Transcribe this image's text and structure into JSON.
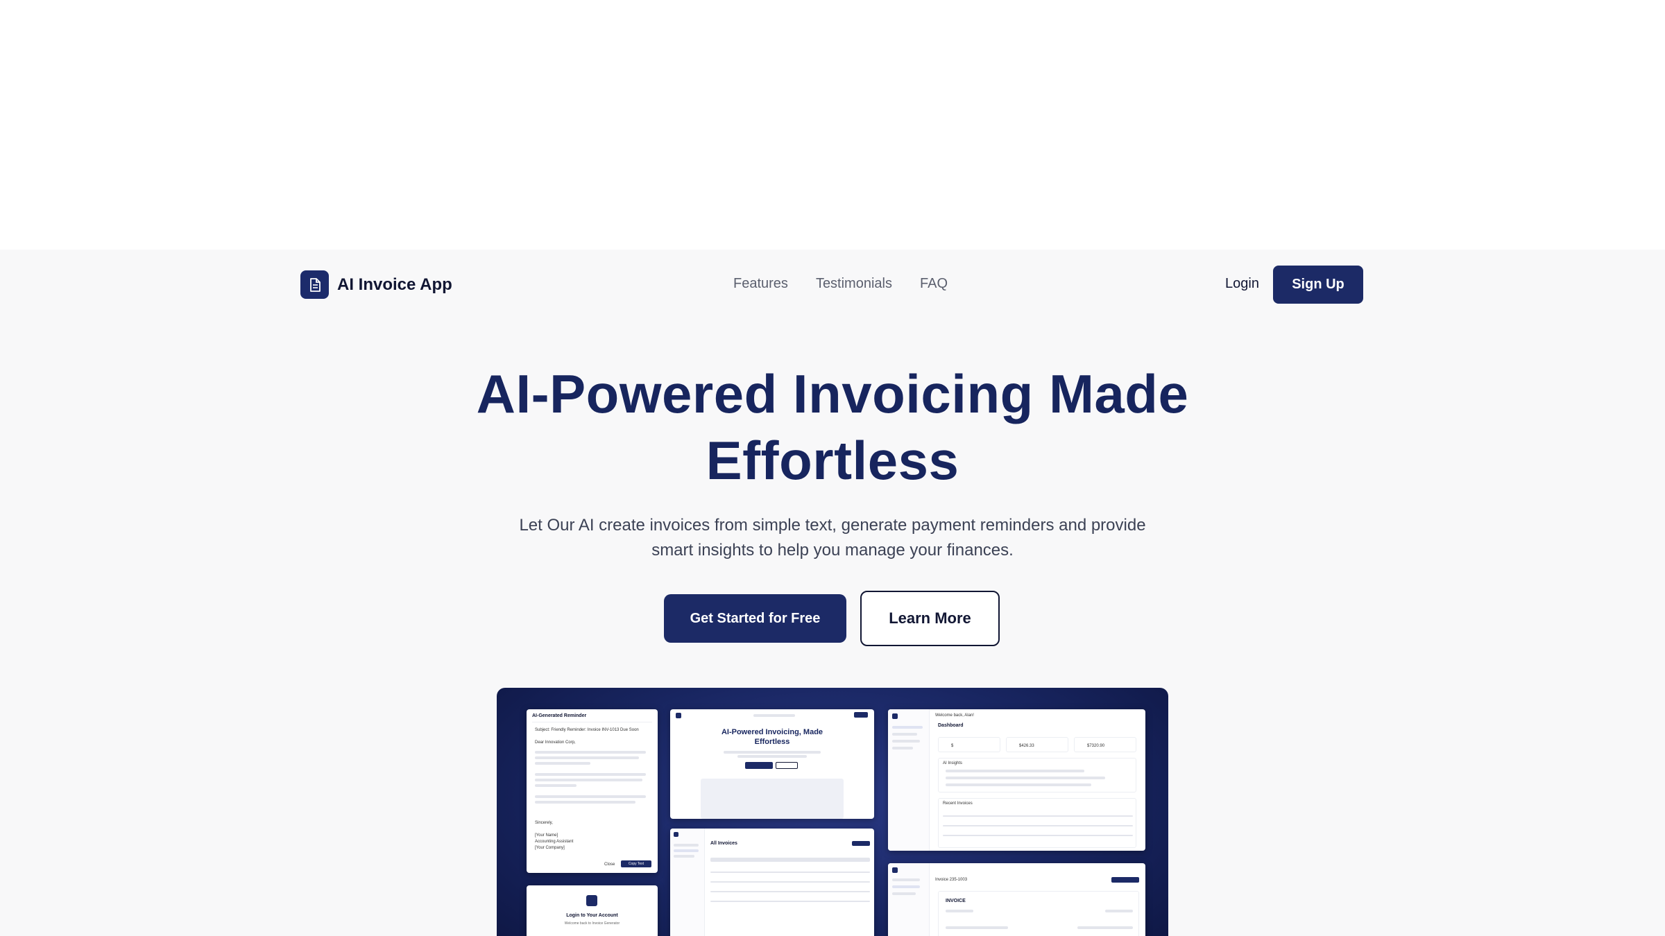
{
  "brand": {
    "name": "AI Invoice App",
    "logo_icon": "document-icon"
  },
  "nav": {
    "links": [
      "Features",
      "Testimonials",
      "FAQ"
    ],
    "login": "Login",
    "signup": "Sign Up"
  },
  "hero": {
    "title_line1": "AI-Powered Invoicing Made",
    "title_line2": "Effortless",
    "subtitle_line1": "Let Our AI create invoices from simple text, generate payment reminders and provide",
    "subtitle_line2": "smart insights to help you manage your finances.",
    "cta_primary": "Get Started for Free",
    "cta_secondary": "Learn More"
  },
  "showcase": {
    "reminder": {
      "header": "AI-Generated Reminder",
      "subject": "Subject: Friendly Reminder: Invoice INV-1013 Due Soon",
      "greeting": "Dear Innovation Corp,",
      "sign_off": "Sincerely,",
      "name": "[Your Name]",
      "role": "Accounting Assistant",
      "company": "[Your Company]",
      "close": "Close",
      "copy": "Copy Text"
    },
    "landing": {
      "title_line1": "AI-Powered Invoicing, Made",
      "title_line2": "Effortless"
    },
    "dashboard": {
      "welcome": "Welcome back, Alan!",
      "title": "Dashboard",
      "stat1": "$",
      "stat2": "$426.33",
      "stat3": "$7320.90",
      "insights": "AI Insights",
      "recent": "Recent Invoices"
    },
    "invoices": {
      "title": "All Invoices"
    },
    "invoice": {
      "number": "Invoice 235-1003",
      "heading": "INVOICE"
    },
    "login": {
      "title": "Login to Your Account",
      "sub": "Welcome back to Invoice Generator"
    }
  },
  "colors": {
    "primary": "#1c2a66",
    "text_dark": "#17255e",
    "background": "#f8f8f9"
  }
}
